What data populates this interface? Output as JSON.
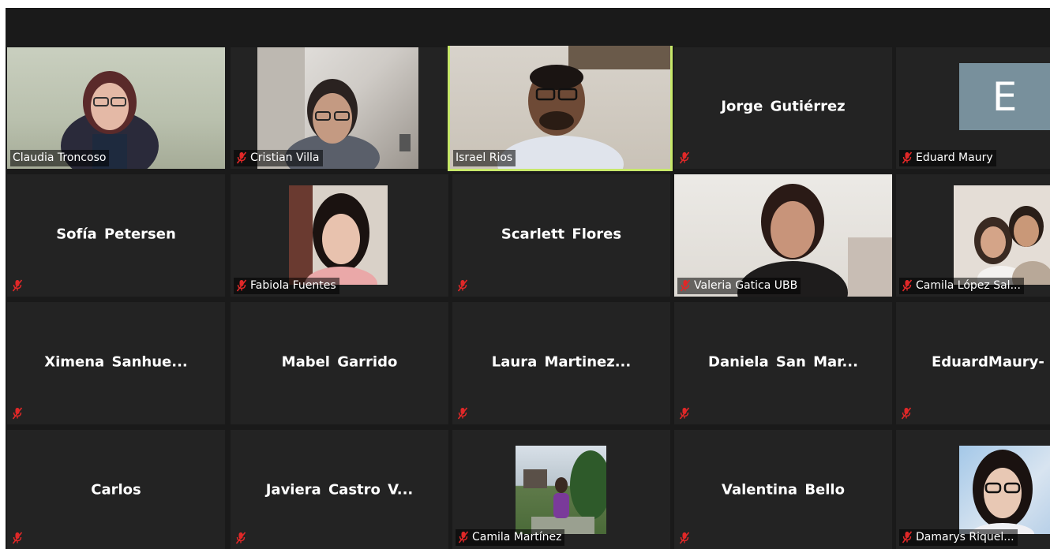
{
  "meeting": {
    "participants": [
      {
        "name": "Claudia Troncoso",
        "muted": false,
        "video": true
      },
      {
        "name": "Cristian Villa",
        "muted": true,
        "video": true
      },
      {
        "name": "Israel Rios",
        "muted": false,
        "video": true,
        "speaking": true
      },
      {
        "name": "Jorge Gutiérrez",
        "muted": true,
        "video": false
      },
      {
        "name": "Eduard Maury",
        "muted": true,
        "video": false,
        "avatar_letter": "E"
      },
      {
        "name": "Sofía Petersen",
        "muted": true,
        "video": false
      },
      {
        "name": "Fabiola Fuentes",
        "muted": true,
        "video": true
      },
      {
        "name": "Scarlett Flores",
        "muted": true,
        "video": false
      },
      {
        "name": "Valeria Gatica UBB",
        "muted": true,
        "video": true
      },
      {
        "name": "Camila López Sal...",
        "muted": true,
        "video": true
      },
      {
        "name": "Ximena  Sanhue...",
        "muted": true,
        "video": false
      },
      {
        "name": "Mabel Garrido",
        "muted": false,
        "video": false
      },
      {
        "name": "Laura  Martinez...",
        "muted": true,
        "video": false
      },
      {
        "name": "Daniela San Mar...",
        "muted": true,
        "video": false
      },
      {
        "name": "EduardMaury-",
        "muted": true,
        "video": false
      },
      {
        "name": "Carlos",
        "muted": true,
        "video": false
      },
      {
        "name": "Javiera Castro V...",
        "muted": true,
        "video": false
      },
      {
        "name": "Camila Martínez",
        "muted": true,
        "video": true
      },
      {
        "name": "Valentina Bello",
        "muted": true,
        "video": false
      },
      {
        "name": "Damarys Riquel...",
        "muted": true,
        "video": true
      }
    ]
  },
  "colors": {
    "background": "#1a1a1a",
    "tile": "#232323",
    "speaker_border": "#c7e86a",
    "mute_icon": "#e02828",
    "avatar": "#78909c"
  },
  "icons": {
    "mute": "microphone-muted-icon"
  }
}
